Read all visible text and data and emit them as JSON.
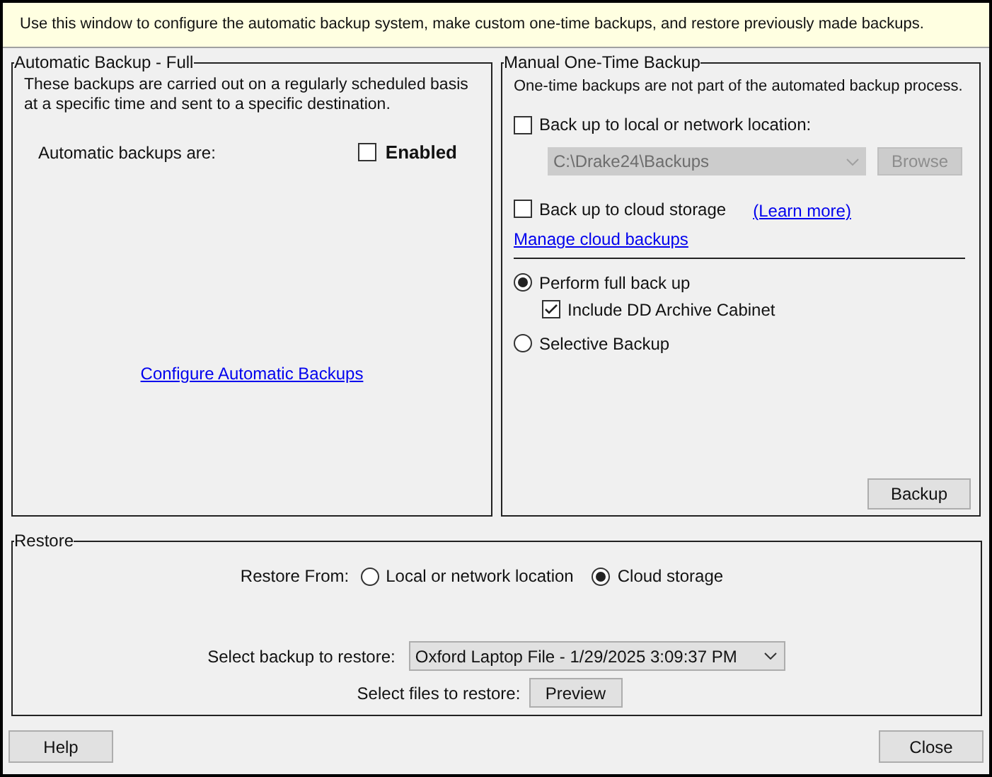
{
  "info_bar": {
    "text": "Use this window to configure the automatic backup system, make custom one-time backups, and restore previously made backups."
  },
  "automatic_backup": {
    "title": "Automatic Backup - Full",
    "description": "These backups are carried out on a regularly scheduled basis at a specific time and sent to a specific destination.",
    "label": "Automatic backups are:",
    "enabled": {
      "label": "Enabled",
      "checked": false
    },
    "link": "Configure Automatic Backups"
  },
  "manual_backup": {
    "title": "Manual One-Time Backup",
    "description": "One-time backups are not part of the automated backup process.",
    "local": {
      "label": "Back up to local or network location:",
      "checked": false,
      "path": {
        "value": "C:\\Drake24\\Backups",
        "disabled": true
      },
      "browse": {
        "label": "Browse",
        "disabled": true
      }
    },
    "cloud": {
      "label": "Back up to cloud storage",
      "checked": false,
      "learn_more": "(Learn more)",
      "manage_link": "Manage cloud backups"
    },
    "modes": [
      {
        "label": "Perform full back up",
        "selected": true,
        "suboption": {
          "label": "Include DD Archive Cabinet",
          "checked": true
        }
      },
      {
        "label": "Selective Backup",
        "selected": false
      }
    ],
    "backup_button": "Backup"
  },
  "restore": {
    "title": "Restore",
    "from_label": "Restore From:",
    "sources": [
      {
        "label": "Local or network location",
        "selected": false
      },
      {
        "label": "Cloud storage",
        "selected": true
      }
    ],
    "backup_label": "Select backup to restore:",
    "backup_value": "Oxford Laptop File - 1/29/2025 3:09:37 PM",
    "files_label": "Select files to restore:",
    "preview_button": "Preview"
  },
  "buttons": [
    "Help",
    "Close"
  ]
}
